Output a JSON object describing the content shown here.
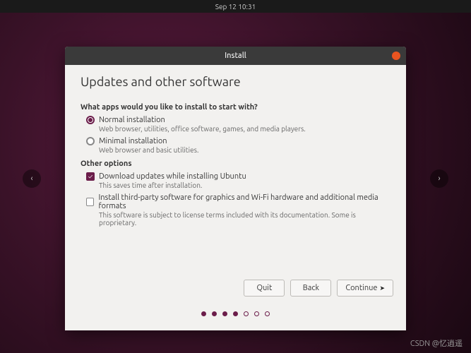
{
  "topbar": {
    "datetime": "Sep 12  10:31"
  },
  "nav": {
    "left_glyph": "‹",
    "right_glyph": "›"
  },
  "window": {
    "title": "Install"
  },
  "page": {
    "heading": "Updates and other software",
    "section1": "What apps would you like to install to start with?",
    "normal_label": "Normal installation",
    "normal_desc": "Web browser, utilities, office software, games, and media players.",
    "minimal_label": "Minimal installation",
    "minimal_desc": "Web browser and basic utilities.",
    "section2": "Other options",
    "download_label": "Download updates while installing Ubuntu",
    "download_desc": "This saves time after installation.",
    "thirdparty_label": "Install third-party software for graphics and Wi-Fi hardware and additional media formats",
    "thirdparty_desc": "This software is subject to license terms included with its documentation. Some is proprietary."
  },
  "buttons": {
    "quit": "Quit",
    "back": "Back",
    "continue": "Continue"
  },
  "progress": {
    "total": 7,
    "filled": 4
  },
  "credit": "CSDN @忆逍遥"
}
